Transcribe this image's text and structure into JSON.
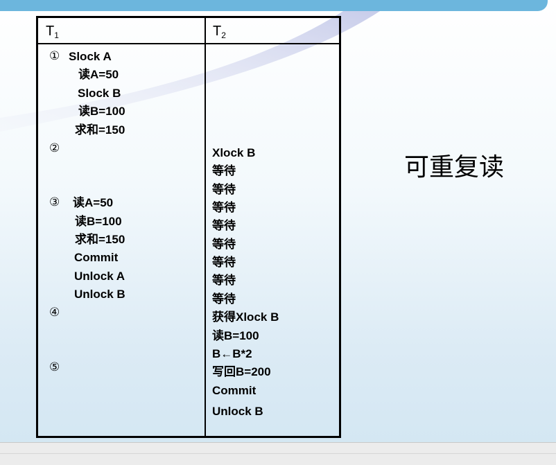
{
  "table": {
    "header": {
      "t1": "T",
      "t1_sub": "1",
      "t2": "T",
      "t2_sub": "2"
    },
    "t1": {
      "s1_marker": "①",
      "s1_line1": "Slock A",
      "s1_line2": "读A=50",
      "s1_line3": "Slock B",
      "s1_line4": "读B=100",
      "s1_line5": "求和=150",
      "s2_marker": "②",
      "s3_marker": "③",
      "s3_line1": "读A=50",
      "s3_line2": "读B=100",
      "s3_line3": "求和=150",
      "s3_line4": "Commit",
      "s3_line5": "Unlock A",
      "s3_line6": "Unlock B",
      "s4_marker": "④",
      "s5_marker": "⑤"
    },
    "t2": {
      "xlock": "Xlock B",
      "wait": [
        "等待",
        "等待",
        "等待",
        "等待",
        "等待",
        "等待",
        "等待",
        "等待"
      ],
      "get": "获得Xlock B",
      "read": "读B=100",
      "calc": "B←B*2",
      "write": "写回B=200",
      "commit": "Commit",
      "unlock": "Unlock B"
    }
  },
  "side_title": "可重复读"
}
